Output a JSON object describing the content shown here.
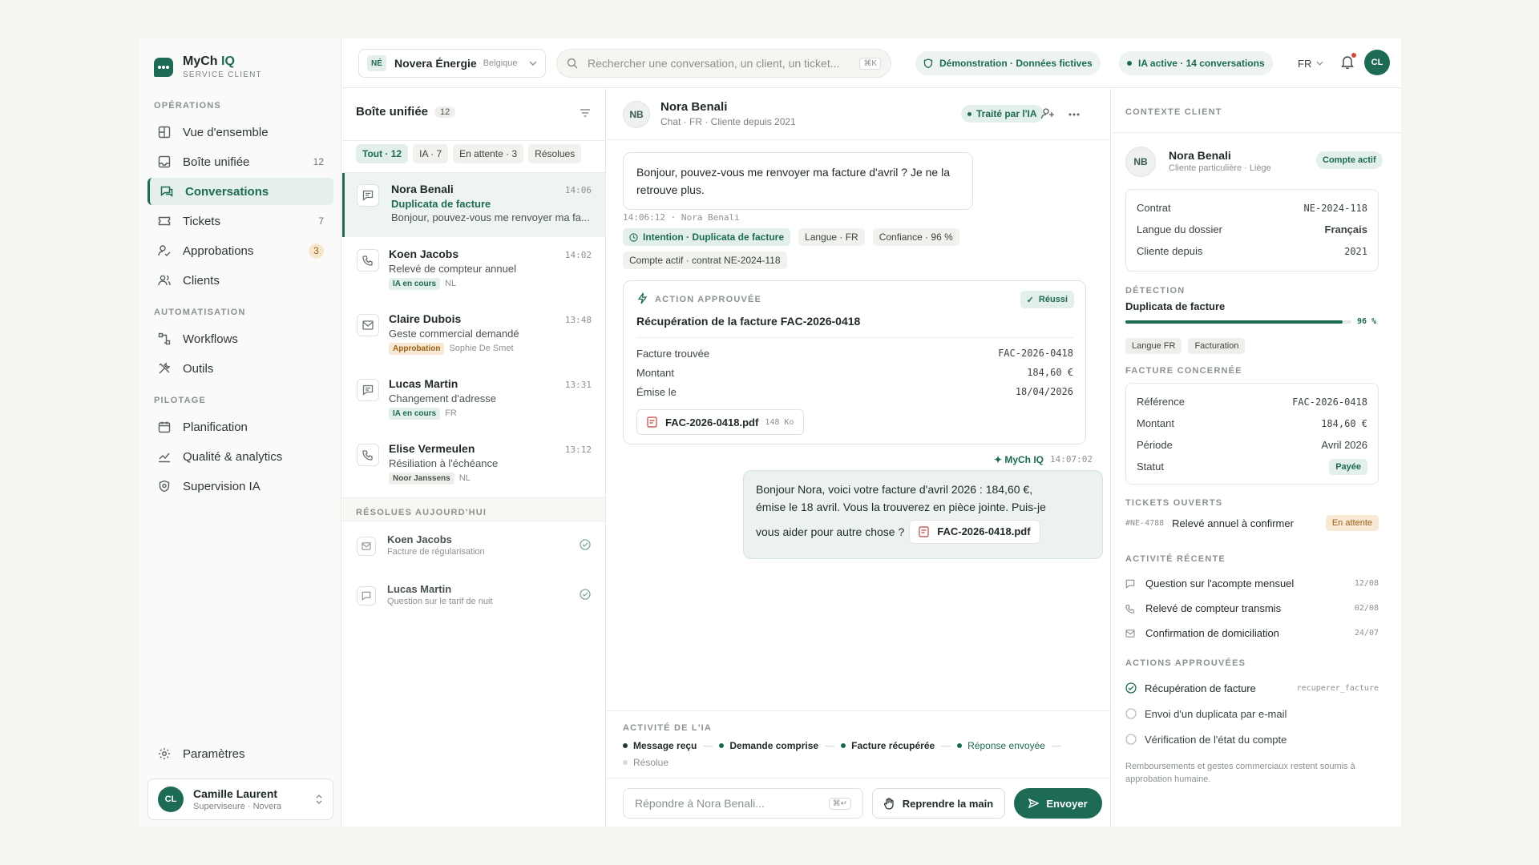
{
  "app": {
    "name_a": "MyCh",
    "name_b": "IQ",
    "subtitle": "SERVICE CLIENT"
  },
  "sidebar": {
    "sections": {
      "ops": "OPÉRATIONS",
      "auto": "AUTOMATISATION",
      "pilot": "PILOTAGE"
    },
    "items": [
      {
        "label": "Vue d'ensemble",
        "icon": "grid-icon"
      },
      {
        "label": "Boîte unifiée",
        "icon": "inbox-icon",
        "count": "12"
      },
      {
        "label": "Conversations",
        "icon": "chat-icon"
      },
      {
        "label": "Tickets",
        "icon": "ticket-icon",
        "count": "7"
      },
      {
        "label": "Approbations",
        "icon": "approval-icon",
        "count": "3"
      },
      {
        "label": "Clients",
        "icon": "users-icon"
      },
      {
        "label": "Workflows",
        "icon": "workflow-icon"
      },
      {
        "label": "Outils",
        "icon": "tools-icon"
      },
      {
        "label": "Planification",
        "icon": "calendar-icon"
      },
      {
        "label": "Qualité & analytics",
        "icon": "analytics-icon"
      },
      {
        "label": "Supervision IA",
        "icon": "shield-icon"
      }
    ],
    "settings": "Paramètres",
    "user": {
      "initials": "CL",
      "name": "Camille Laurent",
      "role": "Superviseure · Novera"
    }
  },
  "topbar": {
    "org_initials": "NÉ",
    "org_name": "Novera Énergie",
    "org_country": "Belgique",
    "search_placeholder": "Rechercher une conversation, un client, un ticket...",
    "search_shortcut": "⌘K",
    "demo_badge": "Démonstration · Données fictives",
    "ai_badge": "IA active · 14 conversations",
    "lang": "FR",
    "avatar": "CL"
  },
  "inbox": {
    "title": "Boîte unifiée",
    "count": "12",
    "filters": [
      "Tout · 12",
      "IA · 7",
      "En attente · 3",
      "Résolues"
    ],
    "items": [
      {
        "name": "Nora Benali",
        "time": "14:06",
        "subject": "Duplicata de facture",
        "preview": "Bonjour, pouvez-vous me renvoyer ma fa...",
        "icon": "chat-icon"
      },
      {
        "name": "Koen Jacobs",
        "time": "14:02",
        "subject": "Relevé de compteur annuel",
        "tag": "IA en cours",
        "extra": "NL",
        "icon": "phone-icon"
      },
      {
        "name": "Claire Dubois",
        "time": "13:48",
        "subject": "Geste commercial demandé",
        "tag": "Approbation",
        "extra": "Sophie De Smet",
        "icon": "mail-icon"
      },
      {
        "name": "Lucas Martin",
        "time": "13:31",
        "subject": "Changement d'adresse",
        "tag": "IA en cours",
        "extra": "FR",
        "icon": "chat-icon"
      },
      {
        "name": "Elise Vermeulen",
        "time": "13:12",
        "subject": "Résiliation à l'échéance",
        "tag": "Noor Janssens",
        "extra": "NL",
        "icon": "phone-icon"
      }
    ],
    "resolved_label": "RÉSOLUES AUJOURD'HUI",
    "resolved": [
      {
        "name": "Koen Jacobs",
        "subject": "Facture de régularisation",
        "icon": "mail-icon"
      },
      {
        "name": "Lucas Martin",
        "subject": "Question sur le tarif de nuit",
        "icon": "chat-icon"
      }
    ]
  },
  "conversation": {
    "initials": "NB",
    "name": "Nora Benali",
    "meta": "Chat · FR · Cliente depuis 2021",
    "status": "Traité par l'IA",
    "message": "Bonjour, pouvez-vous me renvoyer ma facture d'avril ? Je ne la retrouve plus.",
    "message_meta": "14:06:12 · Nora Benali",
    "chips": [
      "Intention · Duplicata de facture",
      "Langue · FR",
      "Confiance · 96 %",
      "Compte actif · contrat NE-2024-118"
    ],
    "action": {
      "label": "ACTION APPROUVÉE",
      "result": "Réussi",
      "title": "Récupération de la facture FAC-2026-0418",
      "rows": [
        {
          "k": "Facture trouvée",
          "v": "FAC-2026-0418"
        },
        {
          "k": "Montant",
          "v": "184,60 €"
        },
        {
          "k": "Émise le",
          "v": "18/04/2026"
        }
      ],
      "file": "FAC-2026-0418.pdf",
      "file_size": "148 Ko"
    },
    "reply_author": "✦ MyCh IQ",
    "reply_time": "14:07:02",
    "reply_line1": "Bonjour Nora, voici votre facture d'avril 2026 : 184,60 €,",
    "reply_line2": "émise le 18 avril. Vous la trouverez en pièce jointe. Puis-je",
    "reply_line3": "vous aider pour autre chose ?",
    "reply_file": "FAC-2026-0418.pdf",
    "activity_label": "ACTIVITÉ DE L'IA",
    "activity": [
      "Message reçu",
      "Demande comprise",
      "Facture récupérée",
      "Réponse envoyée",
      "Résolue"
    ],
    "input_placeholder": "Répondre à Nora Benali...",
    "input_shortcut": "⌘↵",
    "takeover": "Reprendre la main",
    "send": "Envoyer"
  },
  "context": {
    "title": "CONTEXTE CLIENT",
    "client": {
      "initials": "NB",
      "name": "Nora Benali",
      "sub": "Cliente particulière · Liège",
      "badge": "Compte actif"
    },
    "info": [
      {
        "k": "Contrat",
        "v": "NE-2024-118"
      },
      {
        "k": "Langue du dossier",
        "v": "Français"
      },
      {
        "k": "Cliente depuis",
        "v": "2021"
      }
    ],
    "detection_label": "DÉTECTION",
    "detection": "Duplicata de facture",
    "confidence": "96 %",
    "confidence_value": 96,
    "detection_tags": [
      "Langue FR",
      "Facturation"
    ],
    "invoice_label": "FACTURE CONCERNÉE",
    "invoice": [
      {
        "k": "Référence",
        "v": "FAC-2026-0418"
      },
      {
        "k": "Montant",
        "v": "184,60 €"
      },
      {
        "k": "Période",
        "v": "Avril 2026"
      },
      {
        "k": "Statut",
        "v": "Payée"
      }
    ],
    "tickets_label": "TICKETS OUVERTS",
    "ticket": {
      "id": "#NE-4788",
      "title": "Relevé annuel à confirmer",
      "status": "En attente"
    },
    "recent_label": "ACTIVITÉ RÉCENTE",
    "recent": [
      {
        "t": "Question sur l'acompte mensuel",
        "d": "12/08",
        "icon": "chat-icon"
      },
      {
        "t": "Relevé de compteur transmis",
        "d": "02/08",
        "icon": "phone-icon"
      },
      {
        "t": "Confirmation de domiciliation",
        "d": "24/07",
        "icon": "mail-icon"
      }
    ],
    "actions_label": "ACTIONS APPROUVÉES",
    "actions": [
      {
        "t": "Récupération de facture",
        "code": "recuperer_facture",
        "done": true
      },
      {
        "t": "Envoi d'un duplicata par e-mail",
        "done": false
      },
      {
        "t": "Vérification de l'état du compte",
        "done": false
      }
    ],
    "note": "Remboursements et gestes commerciaux restent soumis à approbation humaine."
  },
  "colors": {
    "brand": "#1d6b55",
    "accent_bg": "#e3efea",
    "warn_bg": "#f8e9d5",
    "warn": "#9b5f16"
  }
}
